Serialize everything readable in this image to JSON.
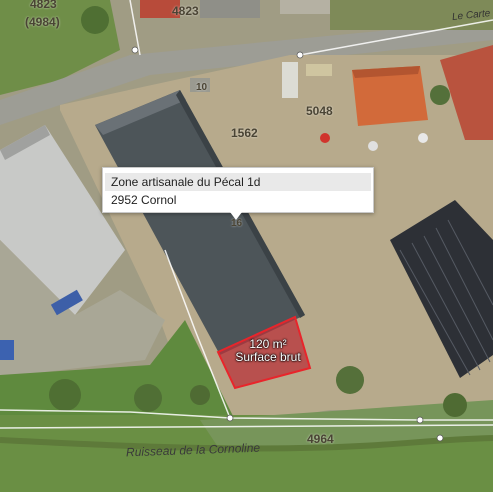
{
  "map": {
    "parcel_labels": [
      {
        "id": "p4823a",
        "text": "4823"
      },
      {
        "id": "p4984",
        "text": "(4984)"
      },
      {
        "id": "p4823b",
        "text": "4823"
      },
      {
        "id": "p1562",
        "text": "1562"
      },
      {
        "id": "p5048",
        "text": "5048"
      },
      {
        "id": "p10",
        "text": "10"
      },
      {
        "id": "p16",
        "text": "16"
      },
      {
        "id": "p4964",
        "text": "4964"
      }
    ],
    "street_label": "Le Carte",
    "stream_label": "Ruisseau de la Cornoline"
  },
  "tooltip": {
    "line1": "Zone artisanale du Pécal 1d",
    "line2": "2952 Cornol"
  },
  "measurement": {
    "area": "120 m²",
    "label": "Surface brut",
    "stroke_color": "#e8252b",
    "fill_color": "#b8323a"
  },
  "colors": {
    "roof_dark": "#4d5559",
    "roof_light": "#c5c6c4",
    "solar_panel": "#2d3036",
    "orange_roof": "#d26a3a",
    "grass": "#6b8a45"
  }
}
